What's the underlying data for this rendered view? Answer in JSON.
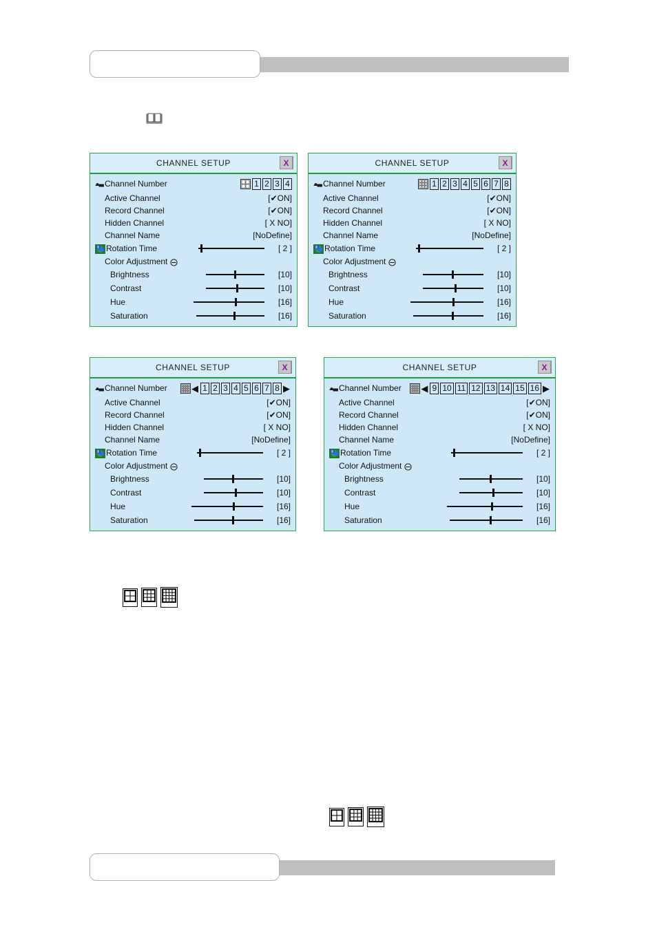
{
  "document": {
    "header_banner": {
      "box_text": "",
      "bar_label": "header-rule"
    },
    "footer_banner": {
      "box_text": "",
      "bar_label": "footer-rule"
    },
    "note_icon": "open-book-icon"
  },
  "common": {
    "title": "CHANNEL SETUP",
    "close_label": "X",
    "labels": {
      "channel_number": "Channel Number",
      "active_channel": "Active  Channel",
      "record_channel": "Record Channel",
      "hidden_channel": "Hidden Channel",
      "channel_name": "Channel Name",
      "rotation_time": "Rotation Time",
      "color_adjustment": "Color Adjustment",
      "brightness": "Brightness",
      "contrast": "Contrast",
      "hue": "Hue",
      "saturation": "Saturation"
    },
    "values": {
      "active_channel": "[✔ON]",
      "record_channel": "[✔ON]",
      "hidden_channel": "[ X NO]",
      "channel_name": "[NoDefine]",
      "rotation_time": "[ 2 ]",
      "brightness": "[10]",
      "contrast": "[10]",
      "hue": "[16]",
      "saturation": "[16]"
    },
    "slider_positions": {
      "rotation_time": 3,
      "brightness": 48,
      "contrast": 52,
      "hue": 58,
      "saturation": 55
    },
    "colors": {
      "panel_bg": "#cfe8f7",
      "panel_border": "#2aa84a",
      "titlebar_bg": "#d8eefb",
      "close_glyph": "#8b1a9b",
      "banner_bar": "#bfbfbf",
      "text": "#111111"
    }
  },
  "panels": [
    {
      "id": "panel-4ch",
      "grid_icon": "grid-2x2-icon",
      "has_prev_arrow": false,
      "has_next_arrow": false,
      "channels": [
        "1",
        "2",
        "3",
        "4"
      ],
      "selected_channel": "1"
    },
    {
      "id": "panel-8ch",
      "grid_icon": "grid-3x3-icon",
      "has_prev_arrow": false,
      "has_next_arrow": false,
      "channels": [
        "1",
        "2",
        "3",
        "4",
        "5",
        "6",
        "7",
        "8"
      ],
      "selected_channel": "1"
    },
    {
      "id": "panel-8ch-paged",
      "grid_icon": "grid-4x4-icon",
      "has_prev_arrow": true,
      "has_next_arrow": true,
      "channels": [
        "1",
        "2",
        "3",
        "4",
        "5",
        "6",
        "7",
        "8"
      ],
      "selected_channel": "6"
    },
    {
      "id": "panel-16ch-page2",
      "grid_icon": "grid-4x4-icon",
      "has_prev_arrow": true,
      "has_next_arrow": true,
      "channels": [
        "9",
        "10",
        "11",
        "12",
        "13",
        "14",
        "15",
        "16"
      ],
      "selected_channel": "16"
    }
  ],
  "icon_strips": [
    {
      "id": "icon-strip-upper",
      "icons": [
        "grid-2x2-icon",
        "grid-3x3-icon",
        "grid-4x4-icon"
      ]
    },
    {
      "id": "icon-strip-lower",
      "icons": [
        "grid-2x2-icon",
        "grid-3x3-icon",
        "grid-4x4-icon"
      ]
    }
  ],
  "arrows": {
    "prev": "◀",
    "next": "▶"
  }
}
